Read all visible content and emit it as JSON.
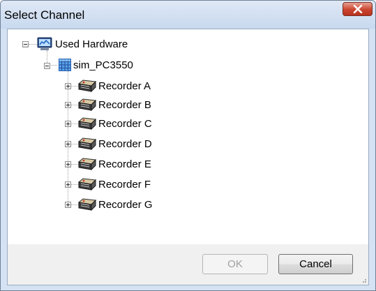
{
  "window": {
    "title": "Select Channel",
    "close_icon": "close-icon"
  },
  "tree": {
    "root": {
      "label": "Used Hardware",
      "icon": "hardware-monitor-icon",
      "expanded": true
    },
    "device": {
      "label": "sim_PC3550",
      "icon": "grid-device-icon",
      "expanded": true
    },
    "recorders": [
      {
        "label": "Recorder A",
        "icon": "recorder-icon",
        "expanded": false
      },
      {
        "label": "Recorder B",
        "icon": "recorder-icon",
        "expanded": false
      },
      {
        "label": "Recorder C",
        "icon": "recorder-icon",
        "expanded": false
      },
      {
        "label": "Recorder D",
        "icon": "recorder-icon",
        "expanded": false
      },
      {
        "label": "Recorder E",
        "icon": "recorder-icon",
        "expanded": false
      },
      {
        "label": "Recorder F",
        "icon": "recorder-icon",
        "expanded": false
      },
      {
        "label": "Recorder G",
        "icon": "recorder-icon",
        "expanded": false
      }
    ]
  },
  "buttons": {
    "ok_label": "OK",
    "ok_enabled": false,
    "cancel_label": "Cancel"
  },
  "colors": {
    "close_button": "#c9442e",
    "frame": "#d4e2f3"
  }
}
